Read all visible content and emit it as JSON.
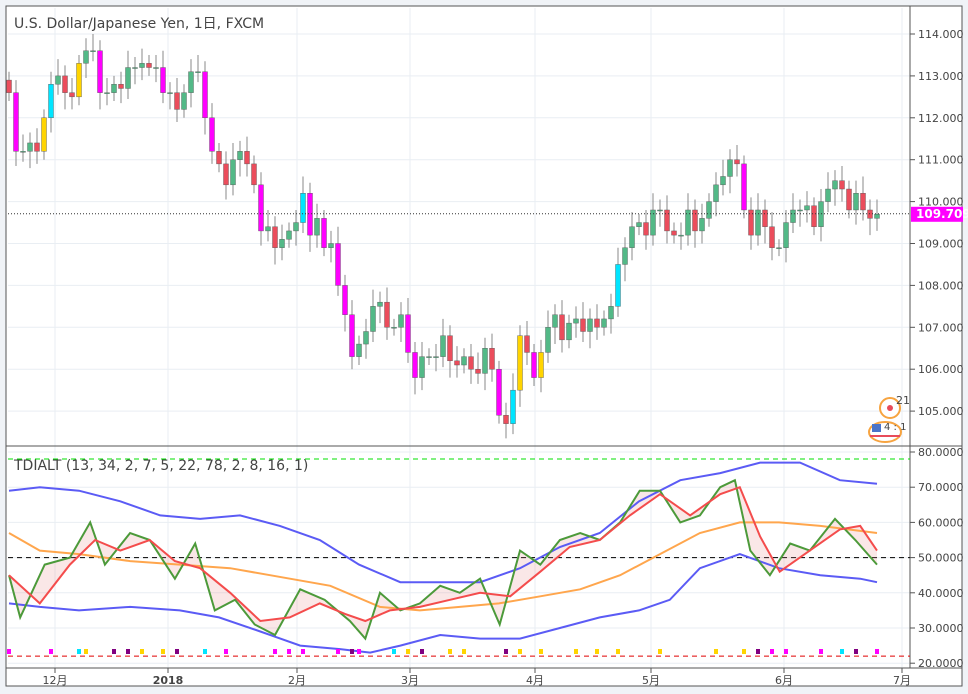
{
  "title": "U.S. Dollar/Japanese Yen, 1日, FXCM",
  "indicator_label": "TDIALT (13, 34, 2, 7, 5, 22, 78, 2, 8, 16, 1)",
  "last_price": "109.709",
  "badges": {
    "top": "21",
    "bottom": "4 : 1"
  },
  "colors": {
    "up": "#53b987",
    "down": "#eb4d5c",
    "tag": "#ff00ff",
    "rsi": "#4c9a3a",
    "signal": "#f44c4c",
    "mid": "#ffa64d",
    "band": "#5b5bf5"
  },
  "chart_data": [
    {
      "type": "candlestick",
      "title": "U.S. Dollar/Japanese Yen, 1日, FXCM",
      "ylim": [
        104.3,
        114.4
      ],
      "yticks": [
        "114.000",
        "113.000",
        "112.000",
        "111.000",
        "110.000",
        "109.000",
        "108.000",
        "107.000",
        "106.000",
        "105.000"
      ],
      "xticks": [
        "12月",
        "2018",
        "2月",
        "3月",
        "4月",
        "5月",
        "6月",
        "7月"
      ],
      "closes": [
        112.6,
        111.2,
        111.2,
        111.4,
        111.2,
        112.0,
        112.8,
        113.0,
        112.6,
        112.5,
        113.3,
        113.6,
        113.6,
        112.6,
        112.6,
        112.8,
        112.7,
        113.2,
        113.2,
        113.3,
        113.2,
        113.2,
        112.6,
        112.6,
        112.2,
        112.6,
        113.1,
        113.1,
        112.0,
        111.2,
        110.9,
        110.4,
        111.0,
        111.2,
        110.9,
        110.4,
        109.3,
        109.4,
        108.9,
        109.1,
        109.3,
        109.5,
        110.2,
        109.2,
        109.6,
        108.9,
        109.0,
        108.0,
        107.3,
        106.3,
        106.6,
        106.9,
        107.5,
        107.6,
        107.0,
        107.0,
        107.3,
        106.4,
        105.8,
        106.3,
        106.3,
        106.3,
        106.8,
        106.2,
        106.1,
        106.3,
        106.0,
        105.9,
        106.5,
        106.0,
        104.9,
        104.7,
        105.5,
        106.8,
        106.4,
        105.8,
        106.4,
        107.0,
        107.3,
        106.7,
        107.1,
        107.2,
        106.9,
        107.2,
        107.0,
        107.2,
        107.5,
        108.5,
        108.9,
        109.4,
        109.5,
        109.2,
        109.8,
        109.8,
        109.3,
        109.2,
        109.2,
        109.8,
        109.3,
        109.6,
        110.0,
        110.4,
        110.6,
        111.0,
        110.9,
        109.8,
        109.2,
        109.8,
        109.4,
        108.9,
        108.9,
        109.5,
        109.8,
        109.8,
        109.9,
        109.4,
        110.0,
        110.3,
        110.5,
        110.3,
        109.8,
        110.2,
        109.8,
        109.6,
        109.7
      ],
      "last": 109.709
    },
    {
      "type": "line",
      "title": "TDIALT (13, 34, 2, 7, 5, 22, 78, 2, 8, 16, 1)",
      "ylim": [
        18,
        82
      ],
      "yticks": [
        "80.0000",
        "70.0000",
        "60.0000",
        "50.0000",
        "40.0000",
        "30.0000",
        "20.0000"
      ],
      "levels": {
        "upper": 78,
        "middle": 50,
        "lower": 22
      },
      "series": [
        {
          "name": "upper band",
          "color": "#5b5bf5",
          "points": [
            [
              0,
              69
            ],
            [
              4.4,
              70
            ],
            [
              10,
              69
            ],
            [
              15.9,
              66
            ],
            [
              21.6,
              62
            ],
            [
              27.3,
              61
            ],
            [
              33,
              62
            ],
            [
              38.7,
              59
            ],
            [
              44.4,
              55
            ],
            [
              50,
              48
            ],
            [
              55.9,
              43
            ],
            [
              61.6,
              43
            ],
            [
              67.3,
              43
            ],
            [
              73,
              47
            ],
            [
              78.7,
              53
            ],
            [
              84.4,
              57
            ],
            [
              90,
              66
            ],
            [
              95.9,
              72
            ],
            [
              101.6,
              74
            ],
            [
              107.3,
              77
            ],
            [
              113,
              77
            ],
            [
              118.7,
              72
            ],
            [
              124,
              71
            ]
          ]
        },
        {
          "name": "lower band",
          "color": "#5b5bf5",
          "points": [
            [
              0,
              37
            ],
            [
              4.4,
              36
            ],
            [
              10,
              35
            ],
            [
              17.3,
              36
            ],
            [
              24.4,
              35
            ],
            [
              30,
              33
            ],
            [
              35.9,
              29
            ],
            [
              41.6,
              25
            ],
            [
              47.3,
              24
            ],
            [
              51.6,
              23
            ],
            [
              55.9,
              25
            ],
            [
              61.6,
              28
            ],
            [
              67.3,
              27
            ],
            [
              73,
              27
            ],
            [
              78.7,
              30
            ],
            [
              84.4,
              33
            ],
            [
              90,
              35
            ],
            [
              94.4,
              38
            ],
            [
              98.7,
              47
            ],
            [
              104.4,
              51
            ],
            [
              110,
              47
            ],
            [
              115.9,
              45
            ],
            [
              121.6,
              44
            ],
            [
              124,
              43
            ]
          ]
        },
        {
          "name": "middle",
          "color": "#ffa64d",
          "points": [
            [
              0,
              57
            ],
            [
              4.4,
              52
            ],
            [
              10,
              51
            ],
            [
              17.3,
              49
            ],
            [
              24.4,
              48
            ],
            [
              31.6,
              47
            ],
            [
              37.3,
              45
            ],
            [
              45.9,
              42
            ],
            [
              53,
              36
            ],
            [
              58.7,
              35
            ],
            [
              64.4,
              36
            ],
            [
              70,
              37
            ],
            [
              75.9,
              39
            ],
            [
              81.6,
              41
            ],
            [
              87.3,
              45
            ],
            [
              93,
              51
            ],
            [
              98.7,
              57
            ],
            [
              104.4,
              60
            ],
            [
              110,
              60
            ],
            [
              115.9,
              59
            ],
            [
              124,
              57
            ]
          ]
        },
        {
          "name": "rsi",
          "color": "#4c9a3a",
          "points": [
            [
              0,
              45
            ],
            [
              1.6,
              33
            ],
            [
              5.1,
              48
            ],
            [
              8.7,
              50
            ],
            [
              11.6,
              60
            ],
            [
              13.7,
              48
            ],
            [
              17.3,
              57
            ],
            [
              20.1,
              55
            ],
            [
              23.7,
              44
            ],
            [
              26.6,
              54
            ],
            [
              29.4,
              35
            ],
            [
              32.3,
              38
            ],
            [
              35.1,
              31
            ],
            [
              38,
              28
            ],
            [
              41.6,
              41
            ],
            [
              45.1,
              38
            ],
            [
              48.7,
              32
            ],
            [
              50.9,
              27
            ],
            [
              53,
              40
            ],
            [
              55.9,
              35
            ],
            [
              58.7,
              37
            ],
            [
              61.6,
              42
            ],
            [
              64.4,
              40
            ],
            [
              67.3,
              44
            ],
            [
              70.1,
              31
            ],
            [
              73,
              52
            ],
            [
              75.9,
              48
            ],
            [
              78.7,
              55
            ],
            [
              81.6,
              57
            ],
            [
              84.4,
              55
            ],
            [
              87.3,
              60
            ],
            [
              90.1,
              69
            ],
            [
              93,
              69
            ],
            [
              95.9,
              60
            ],
            [
              98.7,
              62
            ],
            [
              101.6,
              70
            ],
            [
              103.7,
              72
            ],
            [
              105.9,
              52
            ],
            [
              108.7,
              45
            ],
            [
              111.6,
              54
            ],
            [
              114.4,
              52
            ],
            [
              118,
              61
            ],
            [
              120.9,
              55
            ],
            [
              124,
              48
            ]
          ]
        },
        {
          "name": "signal",
          "color": "#f44c4c",
          "points": [
            [
              0,
              45
            ],
            [
              4.4,
              37
            ],
            [
              8.7,
              48
            ],
            [
              12.3,
              55
            ],
            [
              15.9,
              52
            ],
            [
              20.1,
              55
            ],
            [
              23.7,
              49
            ],
            [
              27.3,
              47
            ],
            [
              31.6,
              40
            ],
            [
              35.9,
              32
            ],
            [
              40.1,
              33
            ],
            [
              44.4,
              37
            ],
            [
              48,
              34
            ],
            [
              50.9,
              32
            ],
            [
              54.4,
              35
            ],
            [
              58.7,
              36
            ],
            [
              63,
              38
            ],
            [
              67.3,
              40
            ],
            [
              71.6,
              39
            ],
            [
              75.9,
              46
            ],
            [
              80.1,
              53
            ],
            [
              84.4,
              55
            ],
            [
              88.7,
              62
            ],
            [
              93,
              68
            ],
            [
              97.3,
              62
            ],
            [
              101.6,
              68
            ],
            [
              104.4,
              70
            ],
            [
              107.3,
              56
            ],
            [
              110.1,
              46
            ],
            [
              114.4,
              52
            ],
            [
              118.7,
              58
            ],
            [
              121.6,
              59
            ],
            [
              124,
              52
            ]
          ]
        }
      ],
      "dots": [
        [
          0,
          "#ff00ff"
        ],
        [
          6,
          "#ff00ff"
        ],
        [
          10,
          "#00e5ff"
        ],
        [
          11,
          "#ffd400"
        ],
        [
          15,
          "#800080"
        ],
        [
          17,
          "#800080"
        ],
        [
          19,
          "#ffd400"
        ],
        [
          22,
          "#ffd400"
        ],
        [
          24,
          "#800080"
        ],
        [
          28,
          "#00e5ff"
        ],
        [
          31,
          "#ff00ff"
        ],
        [
          38,
          "#ff00ff"
        ],
        [
          40,
          "#ff00ff"
        ],
        [
          42,
          "#ff00ff"
        ],
        [
          47,
          "#ff00ff"
        ],
        [
          49,
          "#800080"
        ],
        [
          50,
          "#ff00ff"
        ],
        [
          55,
          "#00e5ff"
        ],
        [
          57,
          "#ffd400"
        ],
        [
          59,
          "#800080"
        ],
        [
          63,
          "#ffd400"
        ],
        [
          65,
          "#ffd400"
        ],
        [
          71,
          "#800080"
        ],
        [
          73,
          "#ffd400"
        ],
        [
          76,
          "#ffd400"
        ],
        [
          81,
          "#ffd400"
        ],
        [
          84,
          "#ffd400"
        ],
        [
          87,
          "#ffd400"
        ],
        [
          93,
          "#ffd400"
        ],
        [
          101,
          "#ffd400"
        ],
        [
          105,
          "#ffd400"
        ],
        [
          107,
          "#800080"
        ],
        [
          109,
          "#ff00ff"
        ],
        [
          111,
          "#ff00ff"
        ],
        [
          116,
          "#ff00ff"
        ],
        [
          119,
          "#00e5ff"
        ],
        [
          121,
          "#800080"
        ],
        [
          124,
          "#ff00ff"
        ]
      ]
    }
  ]
}
